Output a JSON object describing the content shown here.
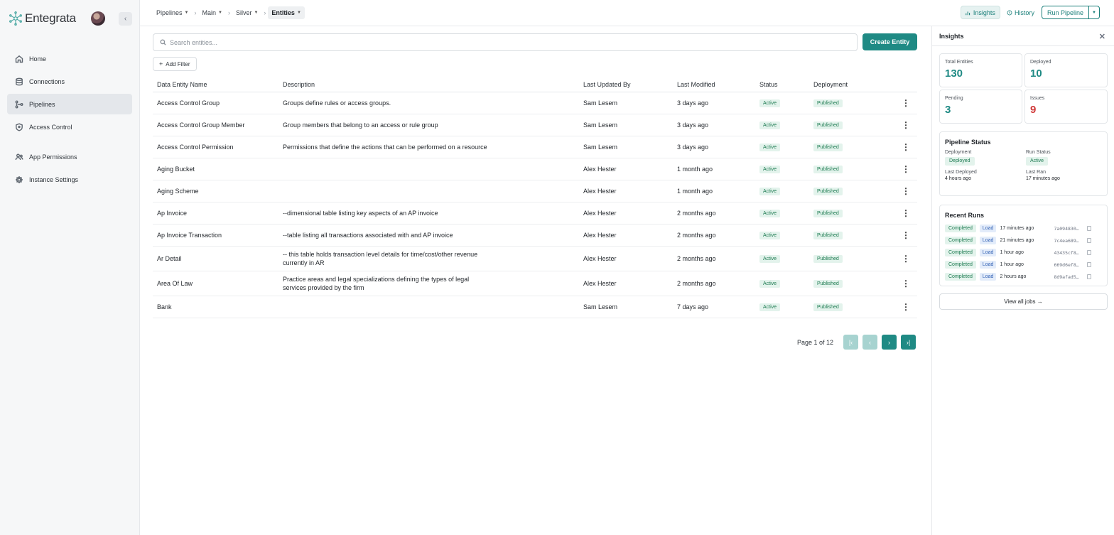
{
  "brand": {
    "name": "Entegrata",
    "accent": "#1f8a84"
  },
  "sidebar": {
    "items": [
      {
        "label": "Home",
        "icon": "home-icon"
      },
      {
        "label": "Connections",
        "icon": "database-icon"
      },
      {
        "label": "Pipelines",
        "icon": "pipeline-icon",
        "active": true
      },
      {
        "label": "Access Control",
        "icon": "shield-icon"
      },
      {
        "label": "App Permissions",
        "icon": "users-icon"
      },
      {
        "label": "Instance Settings",
        "icon": "gear-icon"
      }
    ]
  },
  "breadcrumb": [
    "Pipelines",
    "Main",
    "Silver",
    "Entities"
  ],
  "topbar": {
    "insights": "Insights",
    "history": "History",
    "run": "Run Pipeline"
  },
  "search": {
    "placeholder": "Search entities..."
  },
  "create_label": "Create Entity",
  "filter_label": "Add Filter",
  "table": {
    "columns": [
      "Data Entity Name",
      "Description",
      "Last Updated By",
      "Last Modified",
      "Status",
      "Deployment"
    ],
    "rows": [
      {
        "name": "Access Control Group",
        "desc": "Groups define rules or access groups.",
        "by": "Sam Lesem",
        "modified": "3 days ago",
        "status": "Active",
        "deploy": "Published"
      },
      {
        "name": "Access Control Group Member",
        "desc": "Group members that belong to an access or rule group",
        "by": "Sam Lesem",
        "modified": "3 days ago",
        "status": "Active",
        "deploy": "Published"
      },
      {
        "name": "Access Control Permission",
        "desc": "Permissions that define the actions that can be performed on a resource",
        "by": "Sam Lesem",
        "modified": "3 days ago",
        "status": "Active",
        "deploy": "Published"
      },
      {
        "name": "Aging Bucket",
        "desc": "",
        "by": "Alex Hester",
        "modified": "1 month ago",
        "status": "Active",
        "deploy": "Published"
      },
      {
        "name": "Aging Scheme",
        "desc": "",
        "by": "Alex Hester",
        "modified": "1 month ago",
        "status": "Active",
        "deploy": "Published"
      },
      {
        "name": "Ap Invoice",
        "desc": "--dimensional table listing key aspects of an AP invoice",
        "by": "Alex Hester",
        "modified": "2 months ago",
        "status": "Active",
        "deploy": "Published"
      },
      {
        "name": "Ap Invoice Transaction",
        "desc": "--table listing all transactions associated with and AP invoice",
        "by": "Alex Hester",
        "modified": "2 months ago",
        "status": "Active",
        "deploy": "Published"
      },
      {
        "name": "Ar Detail",
        "desc": "-- this table holds transaction level details for time/cost/other revenue currently in AR",
        "by": "Alex Hester",
        "modified": "2 months ago",
        "status": "Active",
        "deploy": "Published"
      },
      {
        "name": "Area Of Law",
        "desc": "Practice areas and legal specializations defining the types of legal services provided by the firm",
        "by": "Alex Hester",
        "modified": "2 months ago",
        "status": "Active",
        "deploy": "Published"
      },
      {
        "name": "Bank",
        "desc": "",
        "by": "Sam Lesem",
        "modified": "7 days ago",
        "status": "Active",
        "deploy": "Published"
      }
    ]
  },
  "pager": {
    "label": "Page 1 of 12"
  },
  "insights": {
    "title": "Insights",
    "stats": [
      {
        "label": "Total Entities",
        "value": "130"
      },
      {
        "label": "Deployed",
        "value": "10"
      },
      {
        "label": "Pending",
        "value": "3"
      },
      {
        "label": "Issues",
        "value": "9",
        "color": "#d03a3a"
      }
    ],
    "pipeline_status": {
      "title": "Pipeline Status",
      "deployment_label": "Deployment",
      "deployment_value": "Deployed",
      "run_status_label": "Run Status",
      "run_status_value": "Active",
      "last_deployed_label": "Last Deployed",
      "last_deployed_value": "4 hours ago",
      "last_ran_label": "Last Ran",
      "last_ran_value": "17 minutes ago"
    },
    "recent_runs": {
      "title": "Recent Runs",
      "runs": [
        {
          "status": "Completed",
          "type": "Load",
          "time": "17 minutes ago",
          "id": "7a094830…"
        },
        {
          "status": "Completed",
          "type": "Load",
          "time": "21 minutes ago",
          "id": "7c4ea689…"
        },
        {
          "status": "Completed",
          "type": "Load",
          "time": "1 hour ago",
          "id": "43435cf8…"
        },
        {
          "status": "Completed",
          "type": "Load",
          "time": "1 hour ago",
          "id": "669d6ef8…"
        },
        {
          "status": "Completed",
          "type": "Load",
          "time": "2 hours ago",
          "id": "8d9afad5…"
        }
      ]
    },
    "view_all": "View all jobs →"
  }
}
